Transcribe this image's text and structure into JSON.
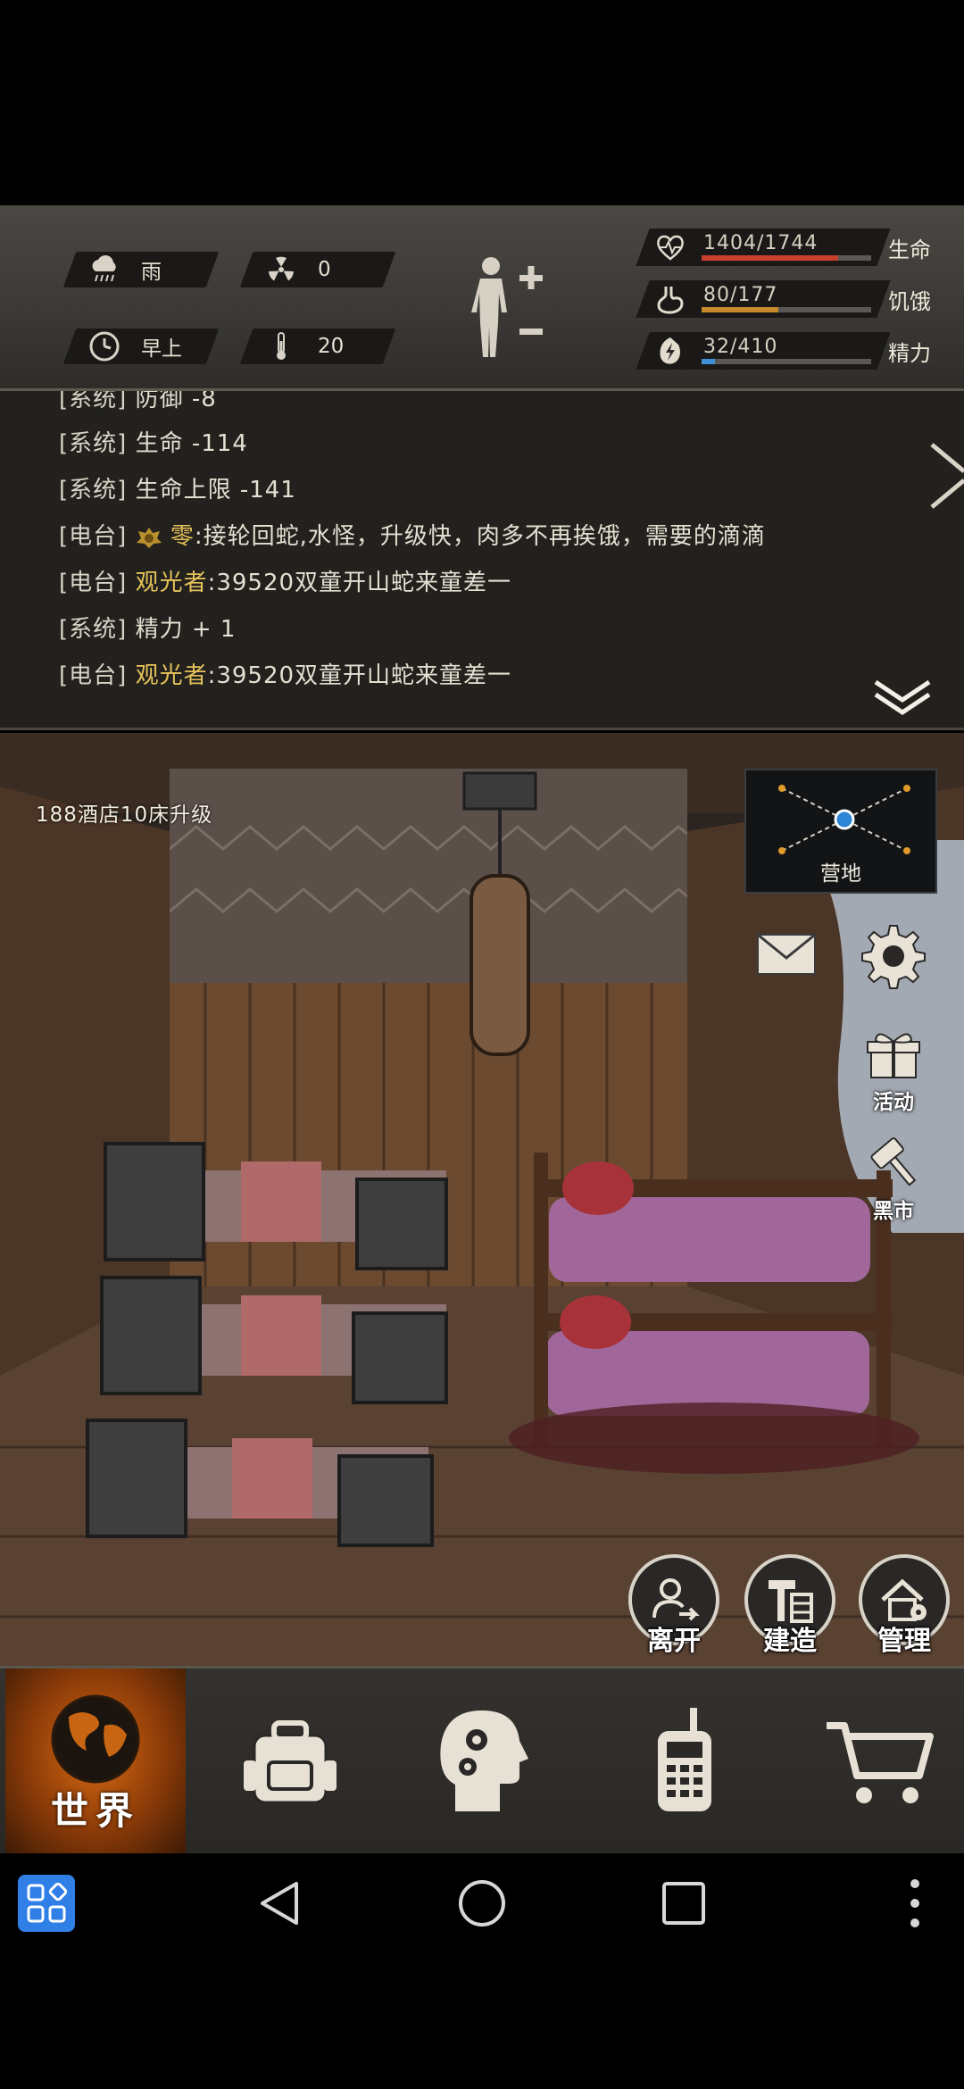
{
  "status": {
    "weather": "雨",
    "radiation": "0",
    "time_of_day": "早上",
    "temperature": "20",
    "vitals": [
      {
        "name": "health",
        "value_text": "1404/1744",
        "label": "生命",
        "fraction": 0.805,
        "color": "#c8412f",
        "icon": "heart-pulse-icon"
      },
      {
        "name": "hunger",
        "value_text": "80/177",
        "label": "饥饿",
        "fraction": 0.452,
        "color": "#c98b2a",
        "icon": "stomach-icon"
      },
      {
        "name": "energy",
        "value_text": "32/410",
        "label": "精力",
        "fraction": 0.078,
        "color": "#3f8fd6",
        "icon": "energy-bolt-icon"
      }
    ]
  },
  "log": {
    "lines": [
      {
        "tag": "[系统]",
        "speaker": "",
        "msg": "防御 -8"
      },
      {
        "tag": "[系统]",
        "speaker": "",
        "msg": "生命 -114"
      },
      {
        "tag": "[系统]",
        "speaker": "",
        "msg": "生命上限 -141"
      },
      {
        "tag": "[电台]",
        "speaker": "零",
        "msg": ":接轮回蛇,水怪，升级快，肉多不再挨饿，需要的滴滴"
      },
      {
        "tag": "[电台]",
        "speaker": "观光者",
        "msg": ":39520双童开山蛇来童差一"
      },
      {
        "tag": "[系统]",
        "speaker": "",
        "msg": "精力 + 1"
      },
      {
        "tag": "[电台]",
        "speaker": "观光者",
        "msg": ":39520双童开山蛇来童差一"
      }
    ]
  },
  "scene": {
    "notice": "188酒店10床升级",
    "map_label": "营地",
    "side_buttons": {
      "activity": "活动",
      "black_market": "黑市"
    },
    "actions": {
      "leave": "离开",
      "build": "建造",
      "manage": "管理"
    }
  },
  "nav": {
    "world": "世界"
  }
}
